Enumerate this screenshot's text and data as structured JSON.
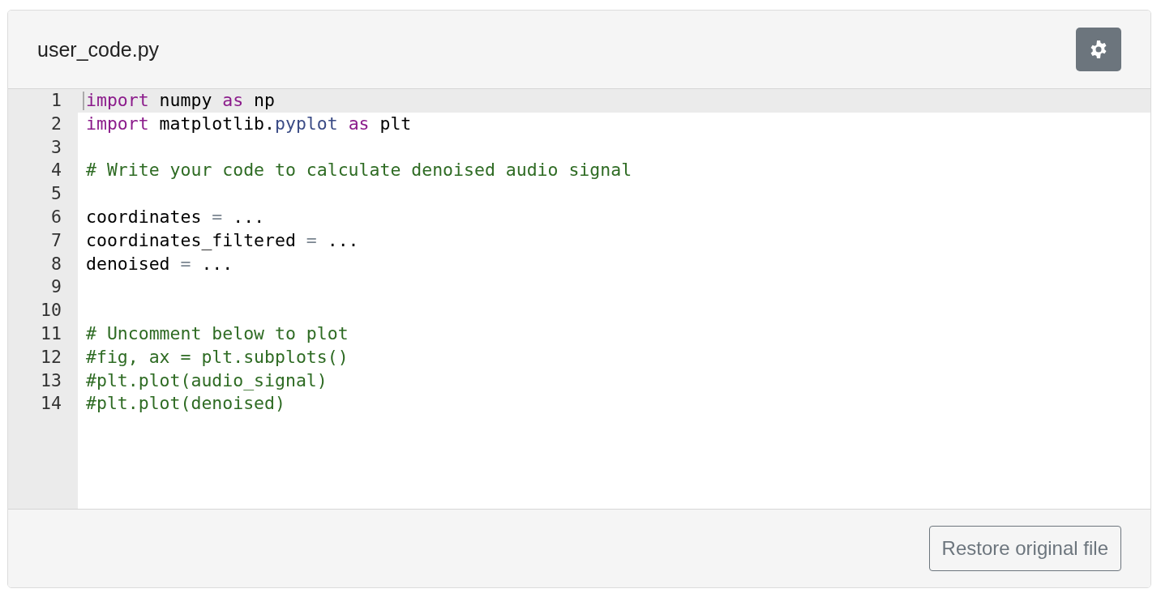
{
  "file_title": "user_code.py",
  "lines": [
    {
      "number": "1",
      "active": true,
      "tokens": [
        {
          "kind": "keyword",
          "text": "import"
        },
        {
          "kind": "plain",
          "text": " numpy "
        },
        {
          "kind": "keyword",
          "text": "as"
        },
        {
          "kind": "plain",
          "text": " np"
        }
      ]
    },
    {
      "number": "2",
      "active": false,
      "tokens": [
        {
          "kind": "keyword",
          "text": "import"
        },
        {
          "kind": "plain",
          "text": " matplotlib."
        },
        {
          "kind": "property",
          "text": "pyplot"
        },
        {
          "kind": "keyword",
          "text": " as"
        },
        {
          "kind": "plain",
          "text": " plt"
        }
      ]
    },
    {
      "number": "3",
      "active": false
    },
    {
      "number": "4",
      "active": false,
      "tokens": [
        {
          "kind": "comment",
          "text": "# Write your code to calculate denoised audio signal"
        }
      ]
    },
    {
      "number": "5",
      "active": false
    },
    {
      "number": "6",
      "active": false,
      "tokens": [
        {
          "kind": "plain",
          "text": "coordinates "
        },
        {
          "kind": "operator",
          "text": "="
        },
        {
          "kind": "plain",
          "text": " ..."
        }
      ]
    },
    {
      "number": "7",
      "active": false,
      "tokens": [
        {
          "kind": "plain",
          "text": "coordinates_filtered "
        },
        {
          "kind": "operator",
          "text": "="
        },
        {
          "kind": "plain",
          "text": " ..."
        }
      ]
    },
    {
      "number": "8",
      "active": false,
      "tokens": [
        {
          "kind": "plain",
          "text": "denoised "
        },
        {
          "kind": "operator",
          "text": "="
        },
        {
          "kind": "plain",
          "text": " ..."
        }
      ]
    },
    {
      "number": "9",
      "active": false
    },
    {
      "number": "10",
      "active": false
    },
    {
      "number": "11",
      "active": false,
      "tokens": [
        {
          "kind": "comment",
          "text": "# Uncomment below to plot"
        }
      ]
    },
    {
      "number": "12",
      "active": false,
      "tokens": [
        {
          "kind": "comment",
          "text": "#fig, ax = plt.subplots()"
        }
      ]
    },
    {
      "number": "13",
      "active": false,
      "tokens": [
        {
          "kind": "comment",
          "text": "#plt.plot(audio_signal)"
        }
      ]
    },
    {
      "number": "14",
      "active": false,
      "tokens": [
        {
          "kind": "comment",
          "text": "#plt.plot(denoised)"
        }
      ]
    }
  ],
  "restore_button": "Restore original file"
}
